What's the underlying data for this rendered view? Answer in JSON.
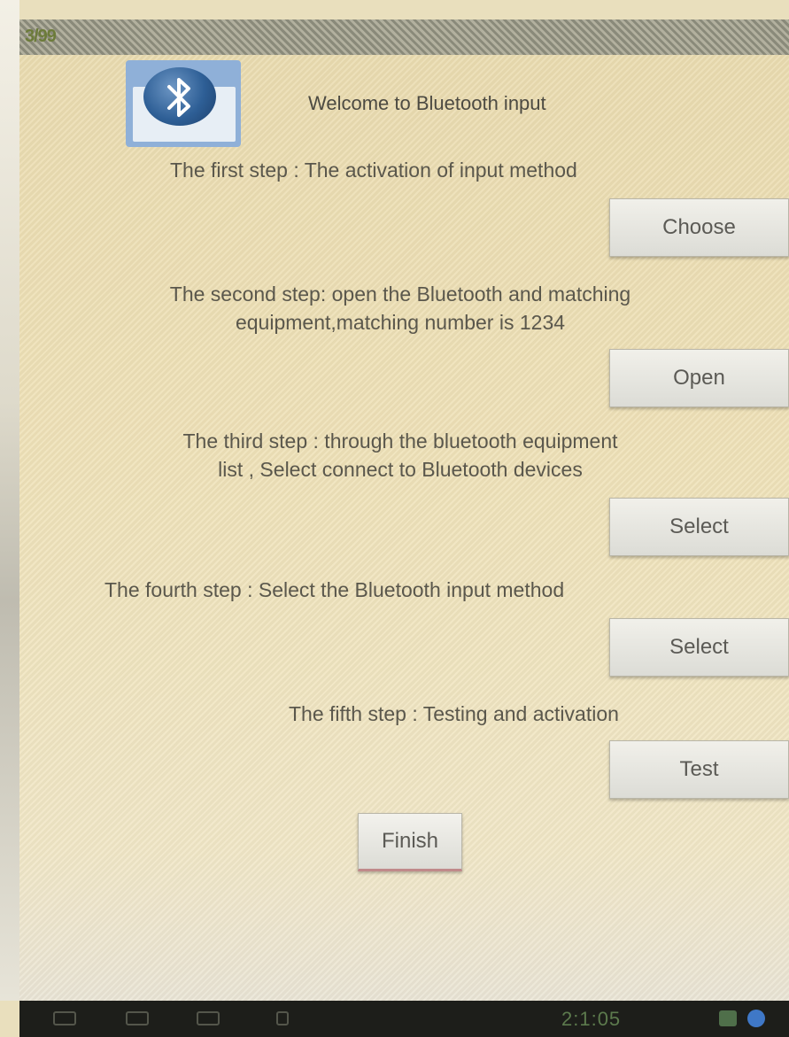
{
  "status_bar": {
    "label": "3/99"
  },
  "header": {
    "welcome_text": "Welcome to Bluetooth input",
    "icon": "bluetooth-icon"
  },
  "steps": [
    {
      "text_line1": "The first step : The activation of input method",
      "text_line2": "",
      "button_label": "Choose"
    },
    {
      "text_line1": "The second step: open the Bluetooth and matching",
      "text_line2": "equipment,matching number is 1234",
      "button_label": "Open"
    },
    {
      "text_line1": "The third step : through the bluetooth equipment",
      "text_line2": "list , Select connect to Bluetooth devices",
      "button_label": "Select"
    },
    {
      "text_line1": "The fourth step : Select the Bluetooth input method",
      "text_line2": "",
      "button_label": "Select"
    },
    {
      "text_line1": "The fifth step : Testing and activation",
      "text_line2": "",
      "button_label": "Test"
    }
  ],
  "finish_label": "Finish",
  "nav_bar": {
    "clock": "2:1:05",
    "icons": [
      "back-icon",
      "home-icon",
      "recent-apps-icon",
      "menu-icon"
    ]
  },
  "colors": {
    "background": "#e9dfbd",
    "text": "#5a574c",
    "button": "#e6e5df",
    "nav_bar": "#1d1e1a"
  }
}
